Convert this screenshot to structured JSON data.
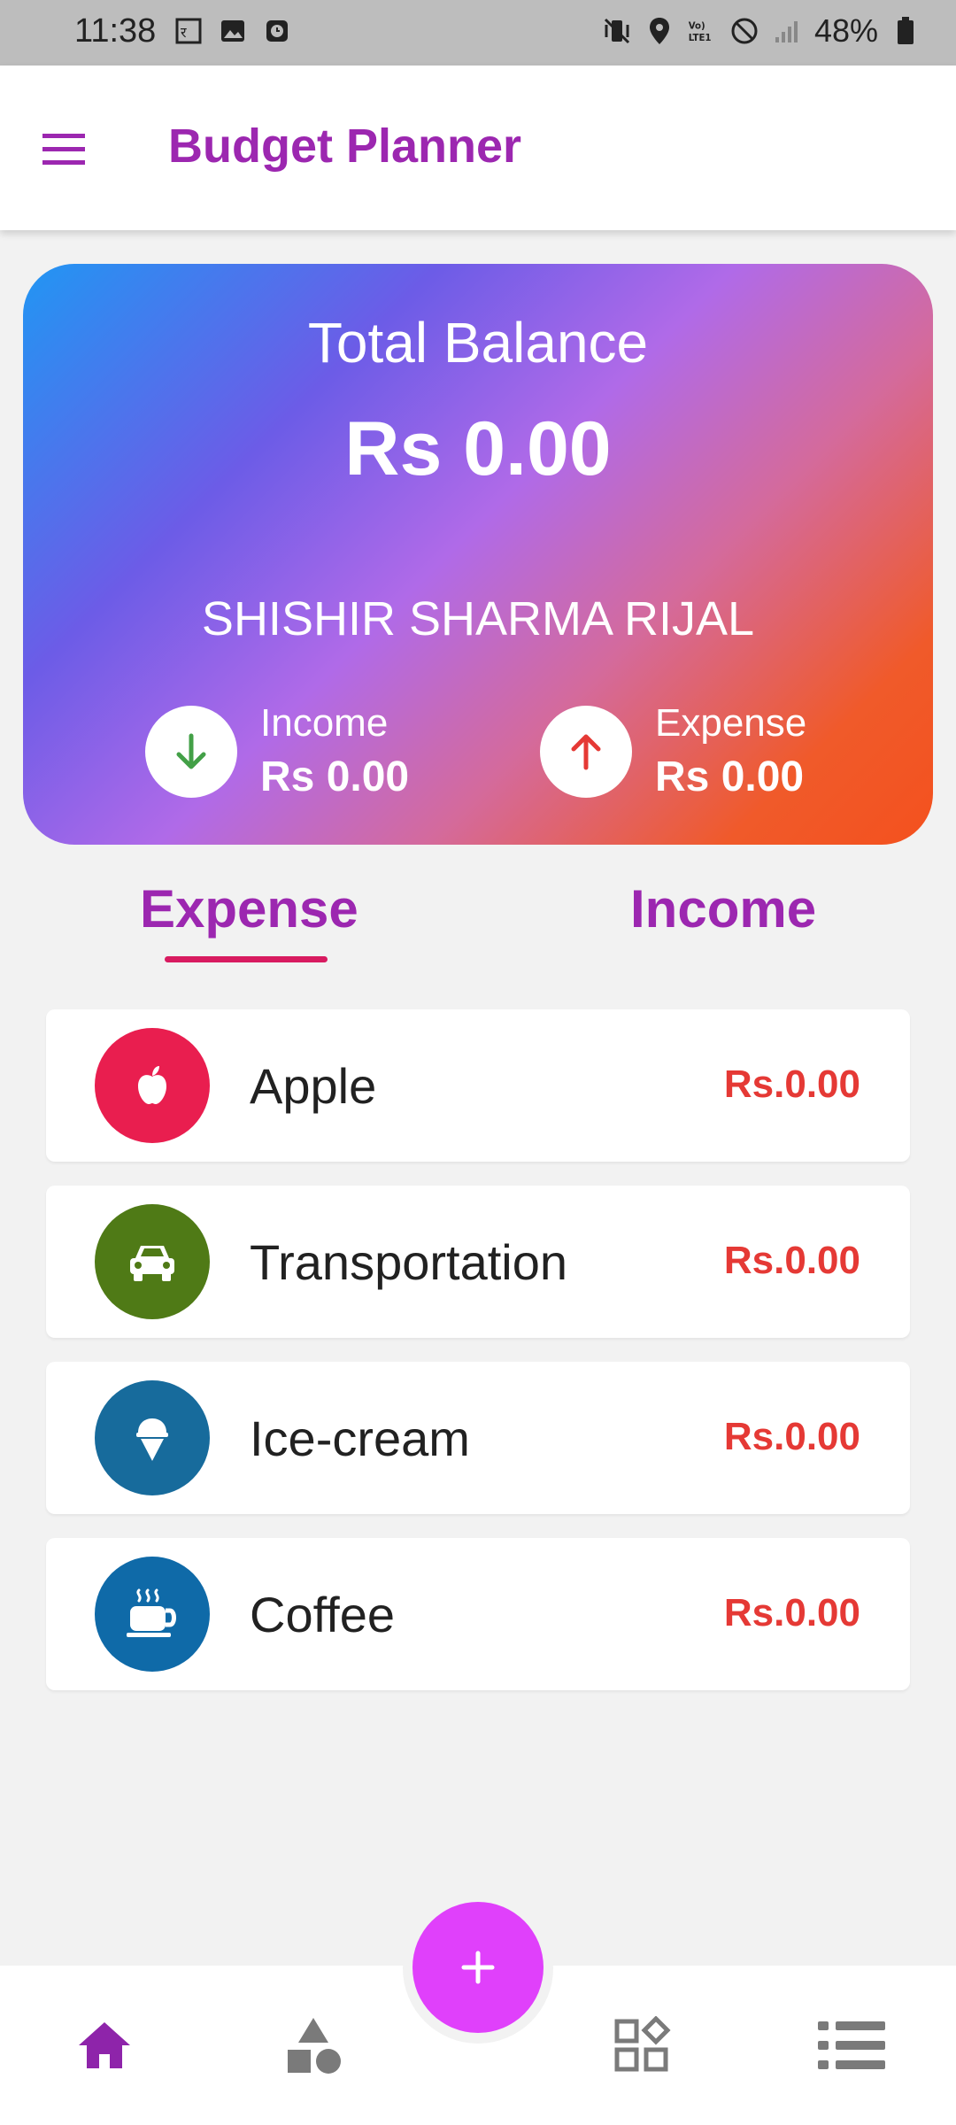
{
  "status_bar": {
    "time": "11:38",
    "battery": "48%",
    "left_icons": [
      "rx-icon",
      "image-icon",
      "alarm-icon"
    ],
    "right_icons": [
      "vibrate-icon",
      "location-icon",
      "volte-icon",
      "dnd-icon",
      "signal-icon",
      "battery-icon"
    ]
  },
  "app_bar": {
    "title": "Budget Planner",
    "menu_icon": "hamburger-icon"
  },
  "balance": {
    "label": "Total Balance",
    "value": "Rs 0.00",
    "owner": "SHISHIR SHARMA RIJAL",
    "income": {
      "label": "Income",
      "value": "Rs 0.00",
      "icon": "arrow-down-icon",
      "color": "#43a047"
    },
    "expense": {
      "label": "Expense",
      "value": "Rs 0.00",
      "icon": "arrow-up-icon",
      "color": "#e53935"
    }
  },
  "tabs": {
    "expense": "Expense",
    "income": "Income",
    "active": "expense"
  },
  "items": [
    {
      "name": "Apple",
      "amount": "Rs.0.00",
      "icon": "apple-icon",
      "color": "#e91e4f"
    },
    {
      "name": "Transportation",
      "amount": "Rs.0.00",
      "icon": "car-icon",
      "color": "#4f7a16"
    },
    {
      "name": "Ice-cream",
      "amount": "Rs.0.00",
      "icon": "ice-cream-icon",
      "color": "#176b9c"
    },
    {
      "name": "Coffee",
      "amount": "Rs.0.00",
      "icon": "coffee-icon",
      "color": "#0f6aa8"
    }
  ],
  "bottom_nav": {
    "items": [
      "home-icon",
      "categories-icon",
      "widgets-icon",
      "list-icon"
    ],
    "fab_icon": "plus-icon",
    "accent": "#8e24aa",
    "inactive": "#7a7a7a"
  }
}
